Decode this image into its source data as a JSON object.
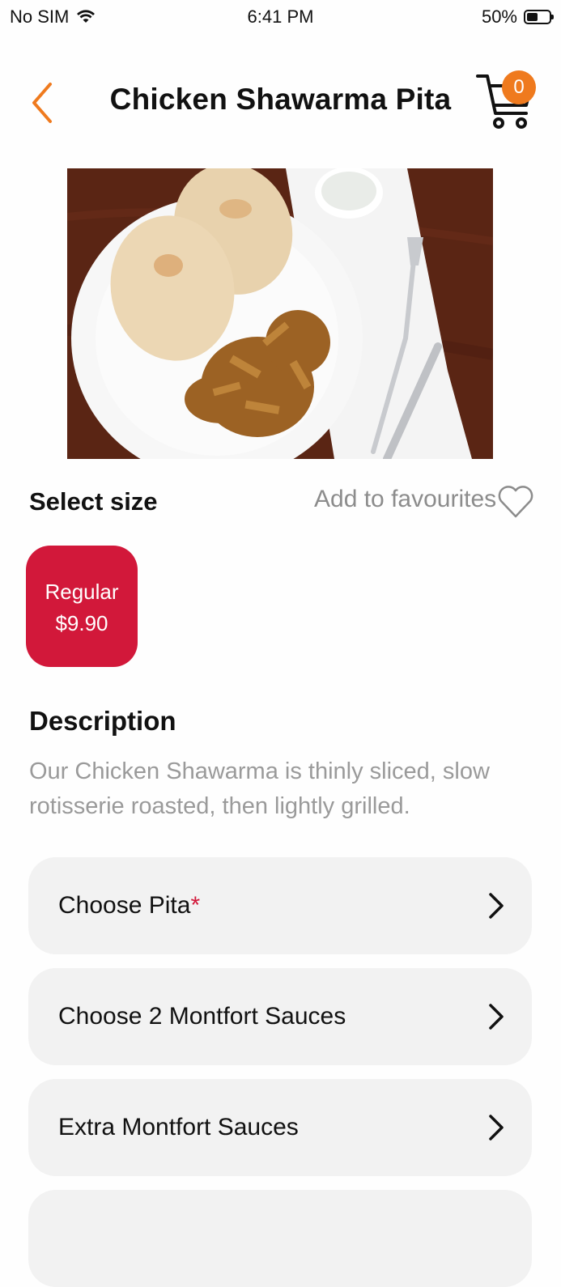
{
  "status_bar": {
    "carrier": "No SIM",
    "time": "6:41 PM",
    "battery": "50%",
    "battery_level": 0.5
  },
  "header": {
    "title": "Chicken Shawarma Pita",
    "cart_count": "0"
  },
  "product": {
    "image_alt": "Chicken shawarma with pita bread on a white plate",
    "select_size_label": "Select size",
    "add_to_favourites": "Add to favourites",
    "sizes": [
      {
        "name": "Regular",
        "price": "$9.90",
        "selected": true
      }
    ],
    "description_heading": "Description",
    "description": "Our Chicken Shawarma is thinly sliced, slow rotisserie roasted, then lightly grilled."
  },
  "options": [
    {
      "label": "Choose Pita",
      "required_mark": "*"
    },
    {
      "label": "Choose 2 Montfort Sauces"
    },
    {
      "label": "Extra Montfort Sauces"
    }
  ],
  "colors": {
    "accent": "#ef7a1e",
    "selected": "#d2183a",
    "option_bg": "#f2f2f2"
  }
}
